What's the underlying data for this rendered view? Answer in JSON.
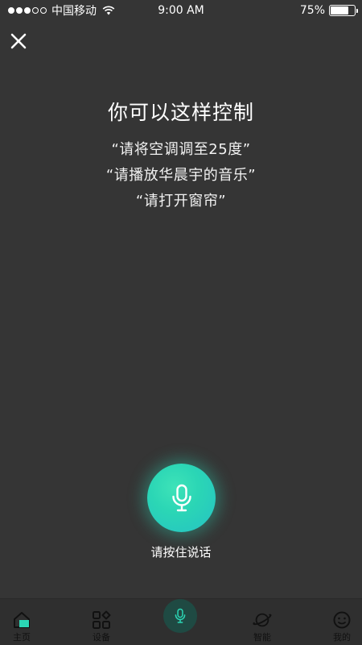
{
  "status_bar": {
    "signal_dots_filled": 3,
    "signal_dots_total": 5,
    "carrier": "中国移动",
    "time": "9:00 AM",
    "battery_text": "75%",
    "battery_level": 0.75
  },
  "header": {
    "close_icon": "close-icon"
  },
  "main": {
    "title": "你可以这样控制",
    "examples": [
      "“请将空调调至25度”",
      "“请播放华晨宇的音乐”",
      "“请打开窗帘”"
    ],
    "mic_icon": "microphone-icon",
    "hold_to_talk": "请按住说话"
  },
  "tabbar": {
    "items": [
      {
        "label": "主页",
        "icon": "home-icon"
      },
      {
        "label": "设备",
        "icon": "devices-icon"
      },
      {
        "label": "",
        "icon": "microphone-icon"
      },
      {
        "label": "智能",
        "icon": "planet-icon"
      },
      {
        "label": "我的",
        "icon": "smiley-face-icon"
      }
    ]
  },
  "colors": {
    "background": "#353535",
    "accent": "#2bd6b5",
    "tabbar": "#2f2f2f"
  }
}
